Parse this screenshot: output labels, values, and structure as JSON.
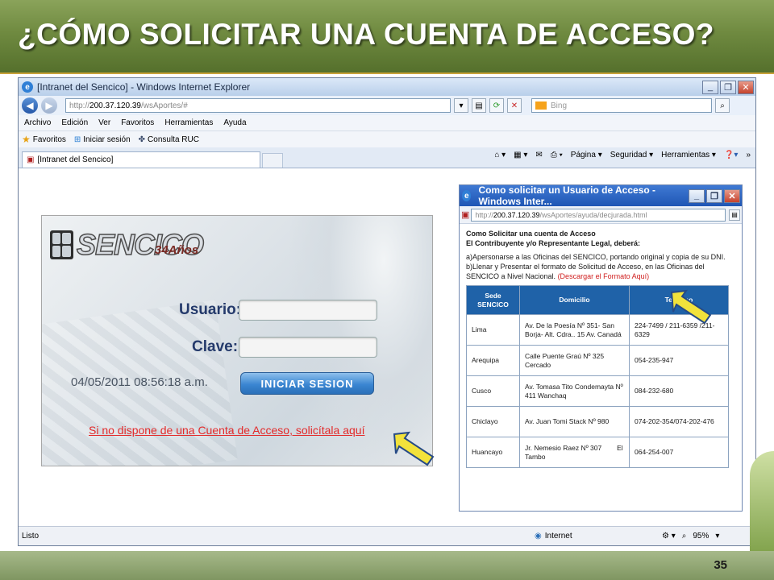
{
  "slide": {
    "title": "¿CÓMO SOLICITAR UNA CUENTA DE ACCESO?",
    "page_number": "35"
  },
  "browser": {
    "window_title": "[Intranet del Sencico] - Windows Internet Explorer",
    "address_prefix": "http://",
    "address_host": "200.37.120.39",
    "address_path": "/wsAportes/#",
    "search_placeholder": "Bing",
    "menu": [
      "Archivo",
      "Edición",
      "Ver",
      "Favoritos",
      "Herramientas",
      "Ayuda"
    ],
    "favorites": {
      "favoritos": "Favoritos",
      "iniciar_sesion": "Iniciar sesión",
      "consulta_ruc": "Consulta RUC"
    },
    "tab_label": "[Intranet del Sencico]",
    "command_bar": [
      "Página ▾",
      "Seguridad ▾",
      "Herramientas ▾"
    ],
    "status_text": "Listo",
    "zone": "Internet",
    "zoom": "95%"
  },
  "login": {
    "logo_text": "SENCICO",
    "logo_years": "34Años",
    "usuario_label": "Usuario:",
    "clave_label": "Clave:",
    "timestamp": "04/05/2011 08:56:18 a.m.",
    "login_button": "INICIAR SESION",
    "signup_link": "Si no dispone de una Cuenta de Acceso, solicítala aquí"
  },
  "popup": {
    "title": "Como solicitar un Usuario de Acceso - Windows Inter...",
    "address_prefix": "http://",
    "address_host": "200.37.120.39",
    "address_path": "/wsAportes/ayuda/decjurada.html",
    "heading1": "Como Solicitar una cuenta de Acceso",
    "heading2": "El Contribuyente y/o Representante Legal, deberá:",
    "step_a": "a)Apersonarse a las Oficinas del SENCICO, portando original y copia de su DNI.",
    "step_b": "b)Llenar y Presentar el formato de Solicitud de Acceso, en las Oficinas del SENCICO a Nivel Nacional.",
    "download_link": "(Descargar el Formato Aquí)",
    "table": {
      "headers": [
        "Sede SENCICO",
        "Domicilio",
        "Telefono"
      ],
      "rows": [
        [
          "Lima",
          "Av. De la Poesía Nº 351- San Borja- Alt. Cdra.. 15 Av. Canadá",
          "224-7499 / 211-6359 /211-6329"
        ],
        [
          "Arequipa",
          "Calle Puente Graú Nº 325 Cercado",
          "054-235-947"
        ],
        [
          "Cusco",
          "Av. Tomasa Tito Condemayta Nº 411 Wanchaq",
          "084-232-680"
        ],
        [
          "Chiclayo",
          "Av. Juan Tomi Stack Nº 980",
          "074-202-354/074-202-476"
        ],
        [
          "Huancayo",
          "Jr. Nemesio Raez Nº 307        El Tambo",
          "064-254-007"
        ]
      ]
    }
  },
  "colors": {
    "slide_green": "#6f8a40",
    "link_red": "#e32a2a",
    "table_header": "#1f62a8",
    "arrow_yellow": "#f2e23b"
  }
}
